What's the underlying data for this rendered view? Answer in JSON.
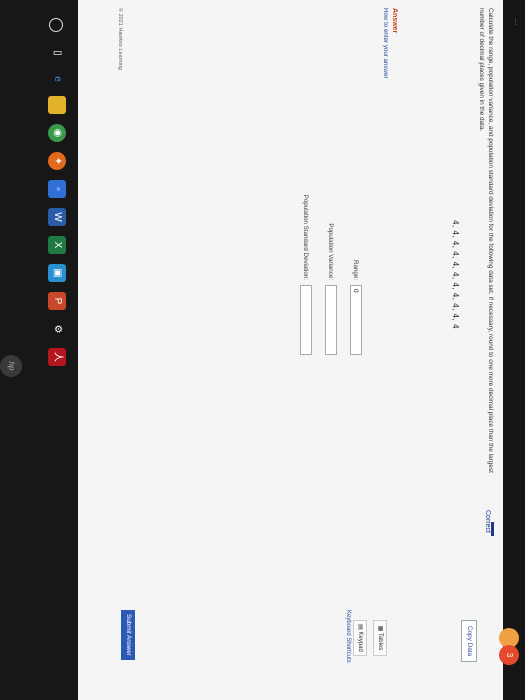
{
  "header": {
    "title": "...",
    "status": "Correct",
    "badge": "3"
  },
  "question": {
    "text": "Calculate the range, population variance, and population standard deviation for the following data set. If necessary, round to one more decimal place than the largest number of decimal places given in the data.",
    "dataset": "4, 4, 4, 4, 4, 4, 4, 4, 4, 4, 4",
    "copy_label": "Copy Data"
  },
  "answer": {
    "heading": "Answer",
    "help_link": "How to enter your answer",
    "fields": [
      {
        "label": "Range:",
        "value": "0"
      },
      {
        "label": "Population Variance:",
        "value": ""
      },
      {
        "label": "Population Standard Deviation:",
        "value": ""
      }
    ]
  },
  "tools": {
    "tables": "Tables",
    "keypad": "Keypad",
    "shortcuts": "Keyboard Shortcuts"
  },
  "submit_label": "Submit Answer",
  "footer": {
    "copyright": "© 2021 Hawkes Learning"
  },
  "taskbar": {
    "items": [
      "start-icon",
      "search-icon",
      "task-view-icon",
      "edge-icon",
      "file-explorer-icon",
      "chrome-icon",
      "firefox-icon",
      "store-icon",
      "word-icon",
      "excel-icon",
      "photos-icon",
      "powerpoint-icon",
      "settings-icon",
      "acrobat-icon"
    ]
  },
  "logo": "hp",
  "colors": {
    "accent": "#2b5ab5",
    "answer_heading": "#d04020",
    "link": "#2b4fa0"
  }
}
